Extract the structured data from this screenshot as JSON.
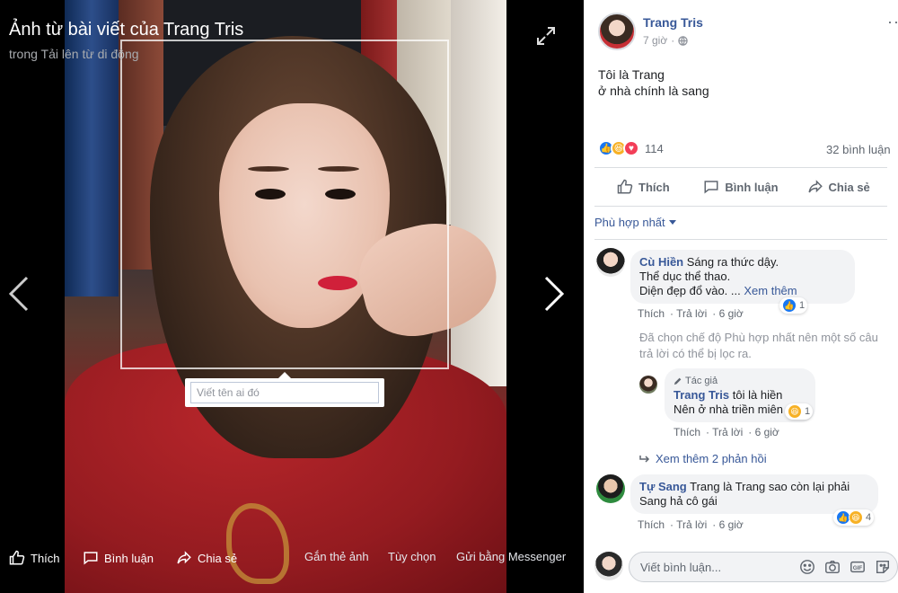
{
  "viewer": {
    "title": "Ảnh từ bài viết của Trang Tris",
    "subtitle": "trong Tải lên từ di động",
    "tag_placeholder": "Viết tên ai đó",
    "bottom": {
      "like": "Thích",
      "comment": "Bình luận",
      "share": "Chia sẻ",
      "tag_photo": "Gắn thẻ ảnh",
      "options": "Tùy chọn",
      "send_messenger": "Gửi bằng Messenger"
    }
  },
  "post": {
    "author": "Trang Tris",
    "time": "7 giờ",
    "text_lines": [
      "Tôi là Trang",
      "ở nhà chính là sang"
    ],
    "reaction_count": "114",
    "comment_count": "32 bình luận",
    "actions": {
      "like": "Thích",
      "comment": "Bình luận",
      "share": "Chia sẻ"
    },
    "sort_label": "Phù hợp nhất"
  },
  "comments": {
    "c1": {
      "name": "Cù Hiền",
      "line1": "Sáng ra thức dậy.",
      "line2": "Thể dục thể thao.",
      "line3": "Diện đẹp đổ vào. ...",
      "see_more": "Xem thêm",
      "like": "Thích",
      "reply": "Trả lời",
      "time": "6 giờ",
      "reactions": "1"
    },
    "filter_note": "Đã chọn chế độ Phù hợp nhất nên một số câu trả lời có thể bị lọc ra.",
    "r1": {
      "badge": "Tác giả",
      "name": "Trang Tris",
      "line1": "tôi là hiền",
      "line2": "Nên ở nhà triền miên",
      "like": "Thích",
      "reply": "Trả lời",
      "time": "6 giờ",
      "reactions": "1"
    },
    "more_replies": "Xem thêm 2 phản hồi",
    "c2": {
      "name": "Tự Sang",
      "line1": "Trang là Trang sao còn lại phải",
      "line2": "Sang hả cô gái",
      "like": "Thích",
      "reply": "Trả lời",
      "time": "6 giờ",
      "reactions": "4"
    }
  },
  "composer": {
    "placeholder": "Viết bình luận..."
  },
  "colors": {
    "link": "#385898",
    "like": "#1877f2",
    "haha": "#f7b125",
    "love": "#f33e58"
  }
}
